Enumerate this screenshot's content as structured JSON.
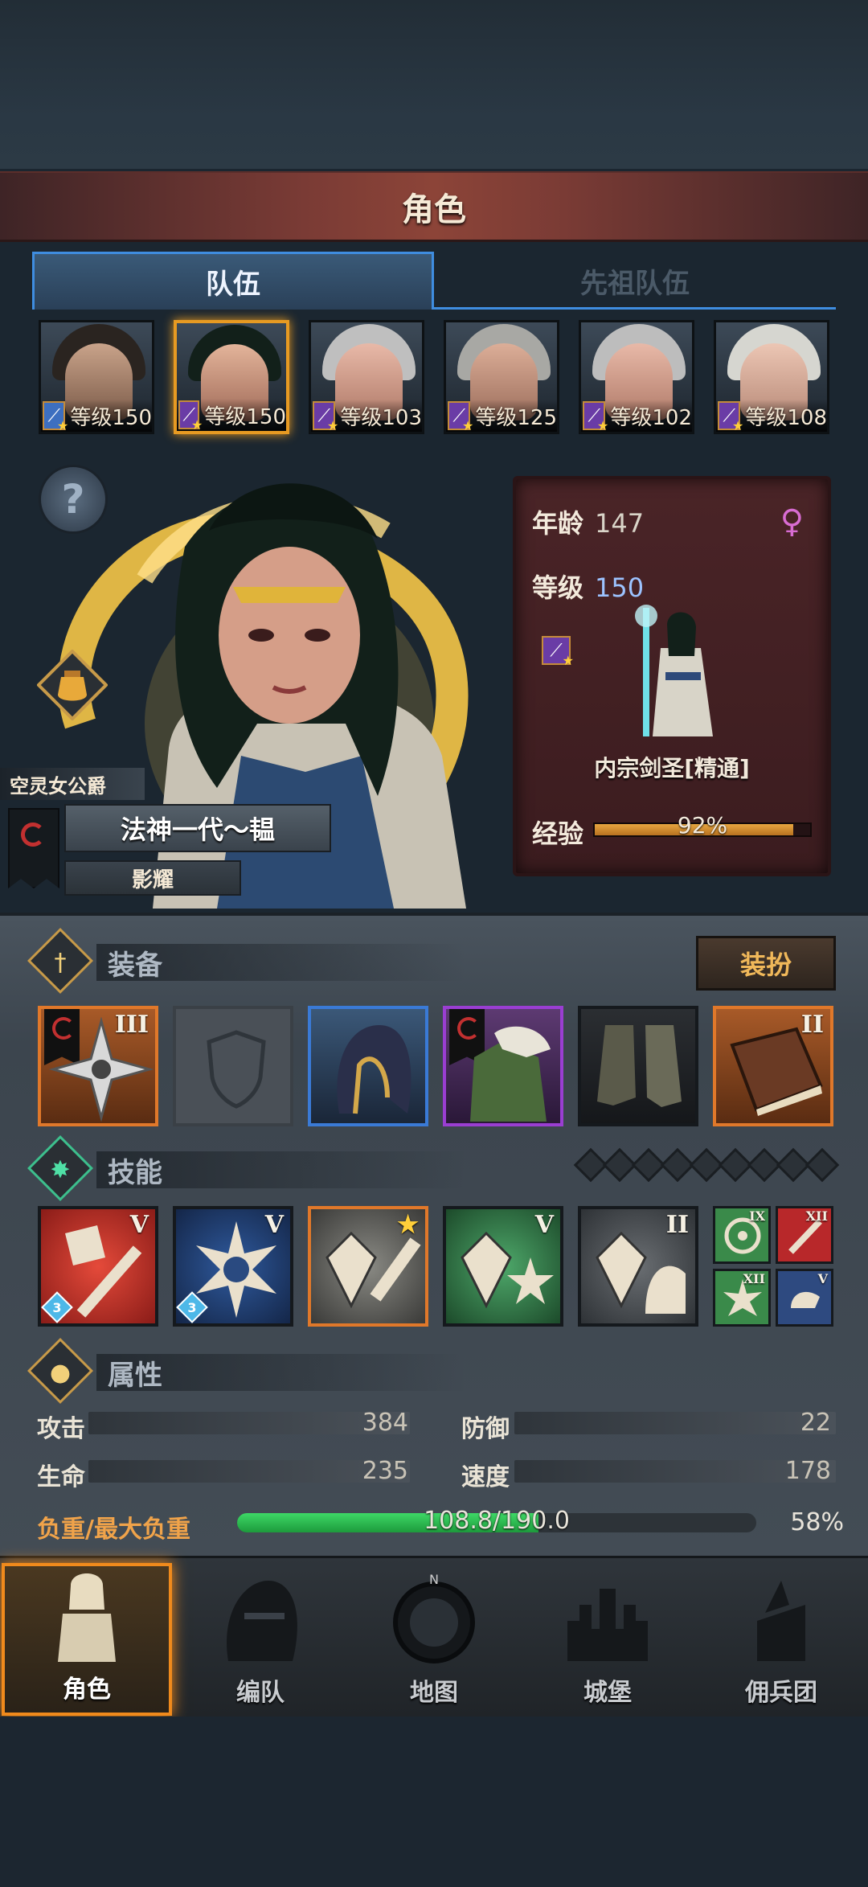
{
  "header": {
    "title": "角色"
  },
  "tabs": [
    {
      "label": "队伍",
      "active": true
    },
    {
      "label": "先祖队伍",
      "active": false
    }
  ],
  "roster": [
    {
      "level_text": "等级150",
      "weapon": "sword-icon",
      "selected": false
    },
    {
      "level_text": "等级150",
      "weapon": "staff-icon",
      "selected": true
    },
    {
      "level_text": "等级103",
      "weapon": "staff-icon",
      "selected": false
    },
    {
      "level_text": "等级125",
      "weapon": "staff-icon",
      "selected": false
    },
    {
      "level_text": "等级102",
      "weapon": "staff-icon",
      "selected": false
    },
    {
      "level_text": "等级108",
      "weapon": "staff-icon",
      "selected": false
    }
  ],
  "hero": {
    "title": "空灵女公爵",
    "name": "法神一代～韫",
    "subtitle": "影耀",
    "age_label": "年龄",
    "age": "147",
    "level_label": "等级",
    "level": "150",
    "class_name": "内宗剑圣[精通]",
    "exp_label": "经验",
    "exp_text": "92%",
    "exp_fraction": 0.92,
    "gender_icon": "female-icon"
  },
  "equipment": {
    "title": "装备",
    "dress_button": "装扮",
    "slots": [
      {
        "name": "shuriken-weapon",
        "tier": "III",
        "rarity": "orange"
      },
      {
        "name": "empty-shield-slot",
        "tier": "",
        "rarity": "empty"
      },
      {
        "name": "hood-helmet",
        "tier": "",
        "rarity": "blue"
      },
      {
        "name": "fur-armor",
        "tier": "",
        "rarity": "purple"
      },
      {
        "name": "wrapped-boots",
        "tier": "",
        "rarity": "dark"
      },
      {
        "name": "tome-accessory",
        "tier": "II",
        "rarity": "orange"
      }
    ]
  },
  "skills": {
    "title": "技能",
    "slots": [
      {
        "tier": "V",
        "badge": "3",
        "color": "red"
      },
      {
        "tier": "V",
        "badge": "3",
        "color": "navy"
      },
      {
        "tier": "★",
        "badge": "",
        "color": "grey"
      },
      {
        "tier": "V",
        "badge": "",
        "color": "green"
      },
      {
        "tier": "II",
        "badge": "",
        "color": "stone"
      }
    ],
    "mini": [
      {
        "tier": "IX",
        "color": "#3a8a4a"
      },
      {
        "tier": "XII",
        "color": "#b8282a"
      },
      {
        "tier": "XII",
        "color": "#3a8a4a"
      },
      {
        "tier": "V",
        "color": "#2e4a80"
      }
    ]
  },
  "attributes": {
    "title": "属性",
    "attack_label": "攻击",
    "attack": "384",
    "defense_label": "防御",
    "defense": "22",
    "hp_label": "生命",
    "hp": "235",
    "speed_label": "速度",
    "speed": "178",
    "load_label": "负重/最大负重",
    "load_text": "108.8/190.0",
    "load_pct": "58%",
    "load_fraction": 0.58
  },
  "nav": [
    {
      "label": "角色",
      "active": true
    },
    {
      "label": "编队",
      "active": false
    },
    {
      "label": "地图",
      "active": false
    },
    {
      "label": "城堡",
      "active": false
    },
    {
      "label": "佣兵团",
      "active": false
    }
  ]
}
